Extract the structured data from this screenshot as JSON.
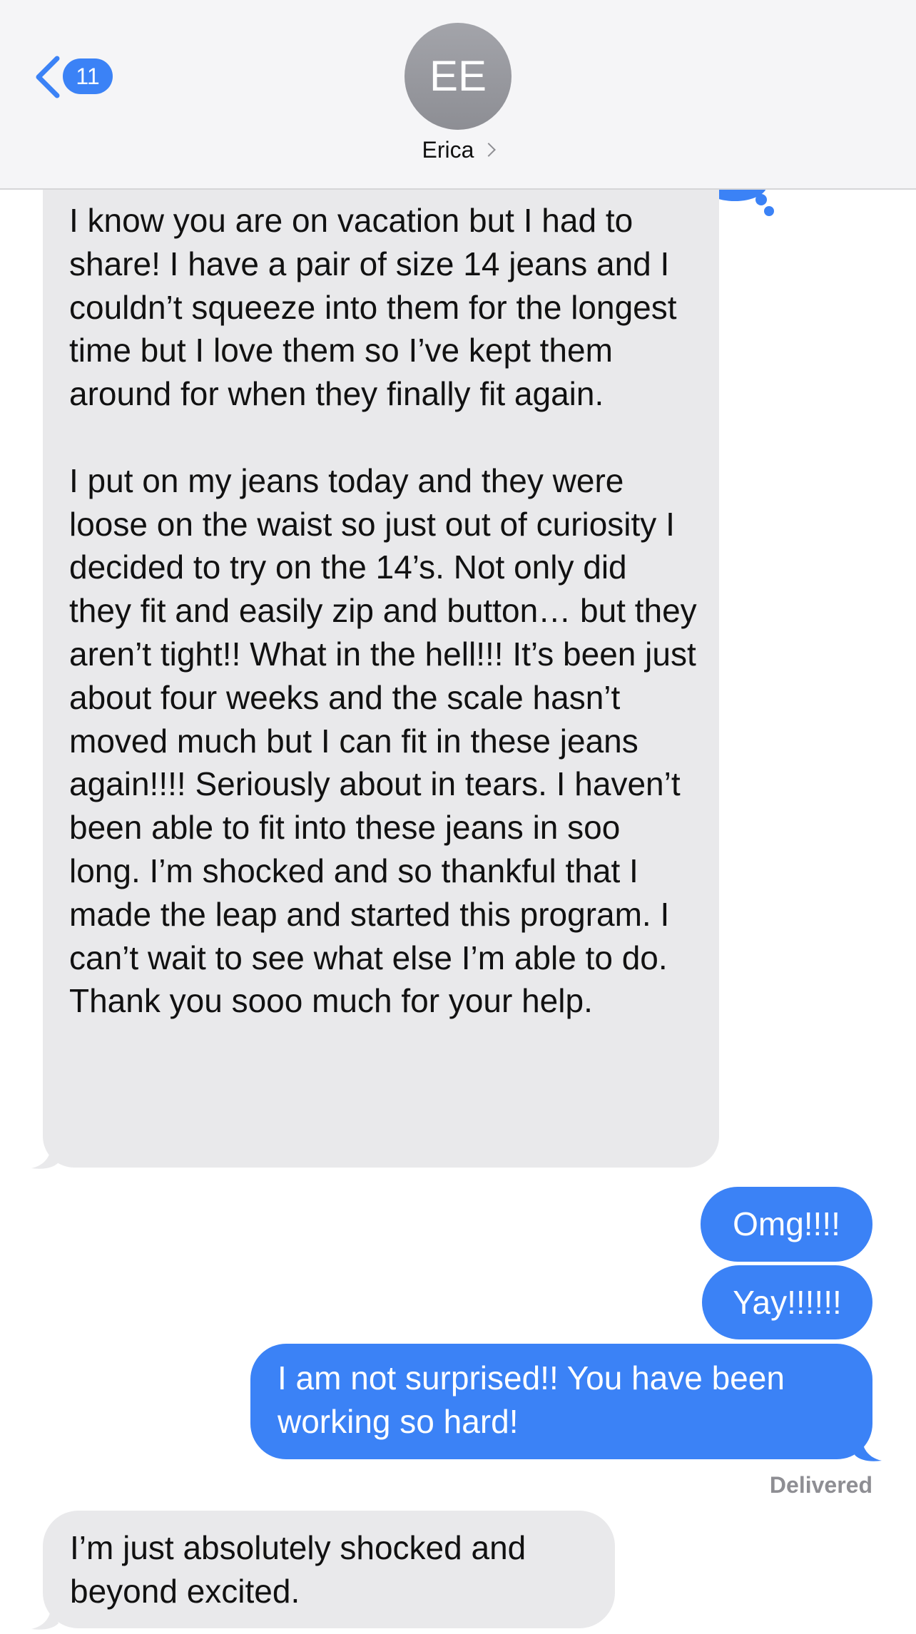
{
  "header": {
    "back_count": "11",
    "avatar_initials": "EE",
    "contact_name": "Erica"
  },
  "messages": [
    {
      "direction": "received",
      "text": "I know you are on vacation but I had to share! I have a pair of size 14 jeans and I couldn’t squeeze into them for the longest time but I love them so I’ve kept them around for when they finally fit again.\n\nI put on my jeans today and they were loose on the waist so just out of curiosity I decided to try on the 14’s. Not only did they fit and easily zip and button… but they aren’t tight!! What in the hell!!! It’s been just about four weeks and the scale hasn’t moved much but I can fit in these jeans again!!!! Seriously about in tears. I haven’t been able to fit into these jeans in soo long. I’m shocked and so thankful that I made the leap and started this program. I can’t wait to see what else I’m able to do. Thank you sooo much for your help."
    },
    {
      "direction": "sent",
      "text": "Omg!!!!"
    },
    {
      "direction": "sent",
      "text": "Yay!!!!!!"
    },
    {
      "direction": "sent",
      "text": "I am not surprised!! You have been working so hard!"
    },
    {
      "direction": "received",
      "text": "I’m just absolutely shocked and beyond excited."
    }
  ],
  "delivered_label": "Delivered",
  "colors": {
    "sent_bubble": "#3b82f6",
    "received_bubble": "#e9e9eb",
    "header_bg": "#f5f5f7"
  }
}
